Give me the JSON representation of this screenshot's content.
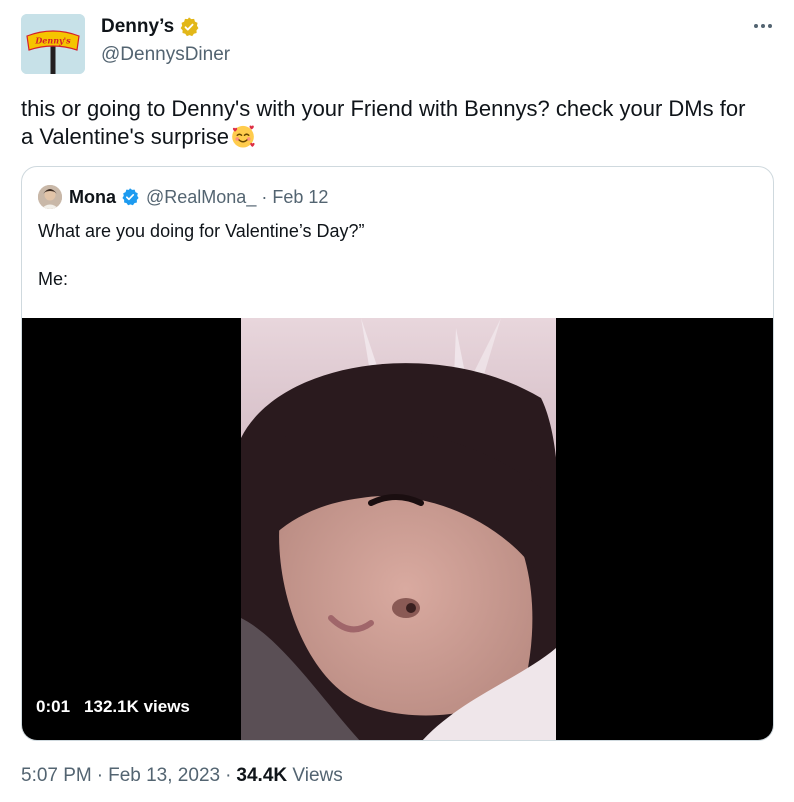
{
  "author": {
    "name": "Denny’s",
    "handle": "@DennysDiner",
    "avatar_logo_text": "Denny's",
    "verified_color": "#e2b719"
  },
  "tweet": {
    "text": "this or going to Denny's with your Friend with Bennys? check your DMs for a Valentine's surprise",
    "emoji": "smiling-face-with-hearts"
  },
  "quoted": {
    "name": "Mona",
    "handle": "@RealMona_",
    "separator": "·",
    "date": "Feb 12",
    "verified_color": "#1d9bf0",
    "line1": "What are you doing for Valentine’s Day?”",
    "line2": "Me:",
    "video": {
      "time": "0:01",
      "views": "132.1K views"
    }
  },
  "meta": {
    "time": "5:07 PM",
    "separator": "·",
    "date": "Feb 13, 2023",
    "views_count": "34.4K",
    "views_label": "Views"
  },
  "colors": {
    "text": "#0f1419",
    "secondary": "#536471",
    "border": "#cfd9de"
  }
}
